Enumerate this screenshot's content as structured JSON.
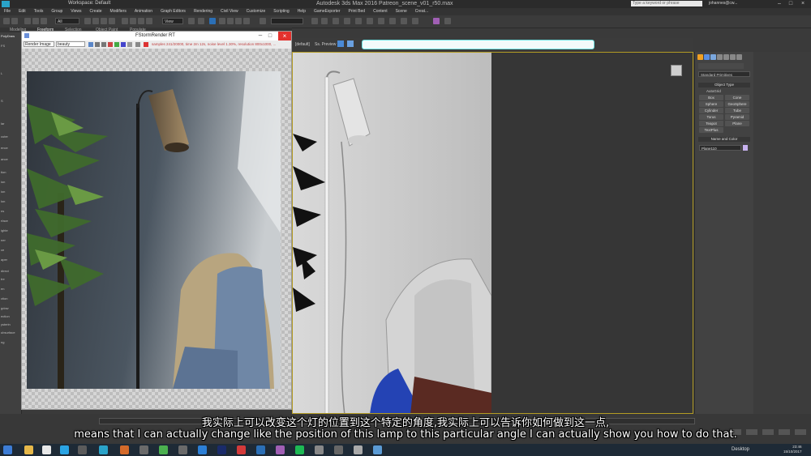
{
  "app": {
    "window_title": "Autodesk 3ds Max 2016     Patreon_scene_v01_r50.max",
    "workspace": "Workspace: Default",
    "search_placeholder": "Type a keyword or phrase",
    "user": "johannes@cw...",
    "colors": {
      "viewport_border": "#b39b23",
      "active_field_border": "#6de2e2",
      "close_red": "#e3312d"
    }
  },
  "menu": [
    "File",
    "Edit",
    "Tools",
    "Group",
    "Views",
    "Create",
    "Modifiers",
    "Animation",
    "Graph Editors",
    "Rendering",
    "Civil View",
    "Customize",
    "Scripting",
    "Help",
    "GameExporter",
    "Print Bed",
    "Content",
    "Scene",
    "Creat..."
  ],
  "toolbar": {
    "selection_set": "All",
    "reference": "View"
  },
  "ribbon": {
    "tabs": [
      "Modeling",
      "Freeform",
      "Selection",
      "Object Paint",
      "Populate"
    ]
  },
  "left_panel": {
    "header": "PolyDraw",
    "labels": [
      "FS",
      "L",
      "S",
      "lar",
      "cuter",
      "ence",
      "ance",
      "tion",
      "ion",
      "ion",
      "lon",
      "ns",
      "rface",
      "ighte",
      "ner",
      "ce",
      "aper",
      "direct",
      "tre",
      "en",
      "ction",
      "gdow",
      "ection",
      "ysterin",
      "ubsurface",
      "ng"
    ]
  },
  "render_window": {
    "title": "FStormRender RT",
    "channel": "Render Image",
    "option": "beauty",
    "stats": "samples 241/20000, time 2m 12s, noise level 1.30%, resolution 800x1000, ..."
  },
  "viewport": {
    "toolbar_left": "[default]",
    "toolbar_mid": "Ss. Preview",
    "cube_label": ""
  },
  "command_panel": {
    "category": "Standard Primitives",
    "object_type_header": "Object Type",
    "autogrid": "AutoGrid",
    "buttons": [
      [
        "Box",
        "Cone"
      ],
      [
        "Sphere",
        "GeoSphere"
      ],
      [
        "Cylinder",
        "Tube"
      ],
      [
        "Torus",
        "Pyramid"
      ],
      [
        "Teapot",
        "Plane"
      ],
      [
        "TextPlus",
        ""
      ]
    ],
    "name_color_header": "Name and Color",
    "name_value": "Plane110"
  },
  "subtitles": {
    "chinese": "我实际上可以改变这个灯的位置到这个特定的角度,我实际上可以告诉你如何做到这一点,",
    "english": "means that I can actually change like the position of this lamp to this particular angle I can actually show you how to do that."
  },
  "taskbar": {
    "desktop_label": "Desktop",
    "time": "23:46",
    "date": "15/10/2017"
  }
}
